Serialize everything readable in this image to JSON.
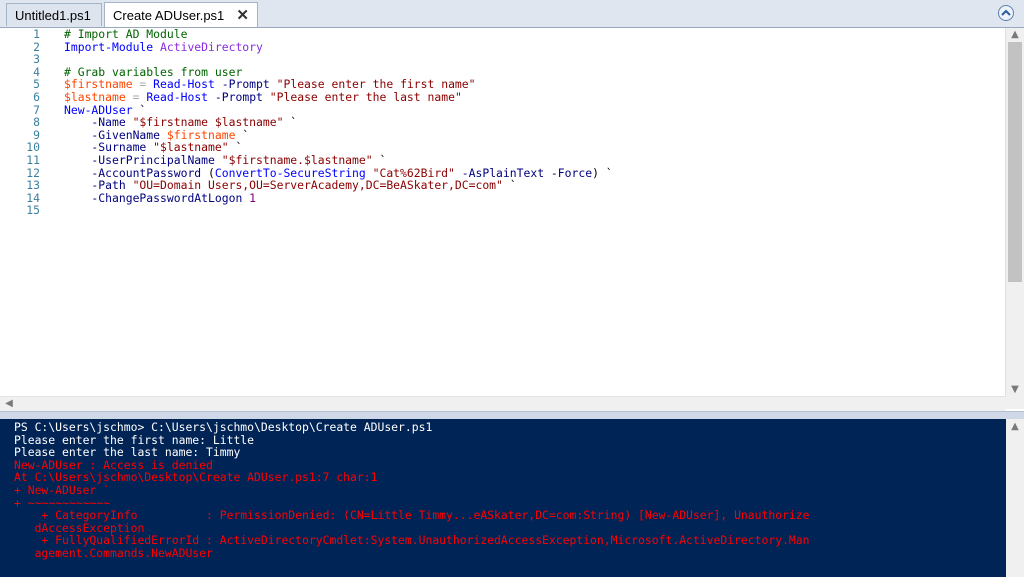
{
  "tabs": [
    {
      "label": "Untitled1.ps1",
      "active": false
    },
    {
      "label": "Create ADUser.ps1",
      "active": true,
      "close": "✕"
    }
  ],
  "editor": {
    "line_numbers": [
      "1",
      "2",
      "3",
      "4",
      "5",
      "6",
      "7",
      "8",
      "9",
      "10",
      "11",
      "12",
      "13",
      "14",
      "15"
    ],
    "lines": [
      [
        {
          "t": "# Import AD Module",
          "c": "cm"
        }
      ],
      [
        {
          "t": "Import-Module",
          "c": "cmd"
        },
        {
          "t": " ",
          "c": "pl"
        },
        {
          "t": "ActiveDirectory",
          "c": "arg"
        }
      ],
      [],
      [
        {
          "t": "# Grab variables from user",
          "c": "cm"
        }
      ],
      [
        {
          "t": "$firstname",
          "c": "var"
        },
        {
          "t": " = ",
          "c": "op"
        },
        {
          "t": "Read-Host",
          "c": "cmd"
        },
        {
          "t": " -Prompt ",
          "c": "prm"
        },
        {
          "t": "\"Please enter the first name\"",
          "c": "str"
        }
      ],
      [
        {
          "t": "$lastname",
          "c": "var"
        },
        {
          "t": " = ",
          "c": "op"
        },
        {
          "t": "Read-Host",
          "c": "cmd"
        },
        {
          "t": " -Prompt ",
          "c": "prm"
        },
        {
          "t": "\"Please enter the last name\"",
          "c": "str"
        }
      ],
      [
        {
          "t": "New-ADUser",
          "c": "cmd"
        },
        {
          "t": " `",
          "c": "pl"
        }
      ],
      [
        {
          "t": "    -Name ",
          "c": "prm"
        },
        {
          "t": "\"$firstname $lastname\"",
          "c": "str"
        },
        {
          "t": " `",
          "c": "pl"
        }
      ],
      [
        {
          "t": "    -GivenName ",
          "c": "prm"
        },
        {
          "t": "$firstname",
          "c": "var"
        },
        {
          "t": " `",
          "c": "pl"
        }
      ],
      [
        {
          "t": "    -Surname ",
          "c": "prm"
        },
        {
          "t": "\"$lastname\"",
          "c": "str"
        },
        {
          "t": " `",
          "c": "pl"
        }
      ],
      [
        {
          "t": "    -UserPrincipalName ",
          "c": "prm"
        },
        {
          "t": "\"$firstname.$lastname\"",
          "c": "str"
        },
        {
          "t": " `",
          "c": "pl"
        }
      ],
      [
        {
          "t": "    -AccountPassword ",
          "c": "prm"
        },
        {
          "t": "(",
          "c": "pl"
        },
        {
          "t": "ConvertTo-SecureString",
          "c": "cmd"
        },
        {
          "t": " ",
          "c": "pl"
        },
        {
          "t": "\"Cat%62Bird\"",
          "c": "str"
        },
        {
          "t": " -AsPlainText -Force",
          "c": "prm"
        },
        {
          "t": ") `",
          "c": "pl"
        }
      ],
      [
        {
          "t": "    -Path ",
          "c": "prm"
        },
        {
          "t": "\"OU=Domain Users,OU=ServerAcademy,DC=BeASkater,DC=com\"",
          "c": "str"
        },
        {
          "t": " `",
          "c": "pl"
        }
      ],
      [
        {
          "t": "    -ChangePasswordAtLogon ",
          "c": "prm"
        },
        {
          "t": "1",
          "c": "num"
        }
      ],
      []
    ]
  },
  "console": {
    "lines": [
      {
        "t": "PS C:\\Users\\jschmo> C:\\Users\\jschmo\\Desktop\\Create ADUser.ps1",
        "c": "white"
      },
      {
        "t": "Please enter the first name: Little",
        "c": "white"
      },
      {
        "t": "Please enter the last name: Timmy",
        "c": "white"
      },
      {
        "t": "New-ADUser : Access is denied",
        "c": "red"
      },
      {
        "t": "At C:\\Users\\jschmo\\Desktop\\Create ADUser.ps1:7 char:1",
        "c": "red"
      },
      {
        "t": "+ New-ADUser `",
        "c": "red"
      },
      {
        "t": "+ ~~~~~~~~~~~~",
        "c": "red"
      },
      {
        "t": "    + CategoryInfo          : PermissionDenied: (CN=Little Timmy...eASkater,DC=com:String) [New-ADUser], Unauthorize",
        "c": "red"
      },
      {
        "t": "   dAccessException",
        "c": "red"
      },
      {
        "t": "    + FullyQualifiedErrorId : ActiveDirectoryCmdlet:System.UnauthorizedAccessException,Microsoft.ActiveDirectory.Man",
        "c": "red"
      },
      {
        "t": "   agement.Commands.NewADUser",
        "c": "red"
      }
    ]
  },
  "colors": {
    "console_bg": "#012456",
    "error": "#ff0000",
    "comment": "#006400",
    "command": "#0000ff",
    "variable": "#ff4500",
    "string": "#8b0000"
  },
  "icons": {
    "collapse": "chevron-up-icon",
    "scroll_up": "▲",
    "scroll_down": "▼",
    "scroll_left": "◀"
  }
}
